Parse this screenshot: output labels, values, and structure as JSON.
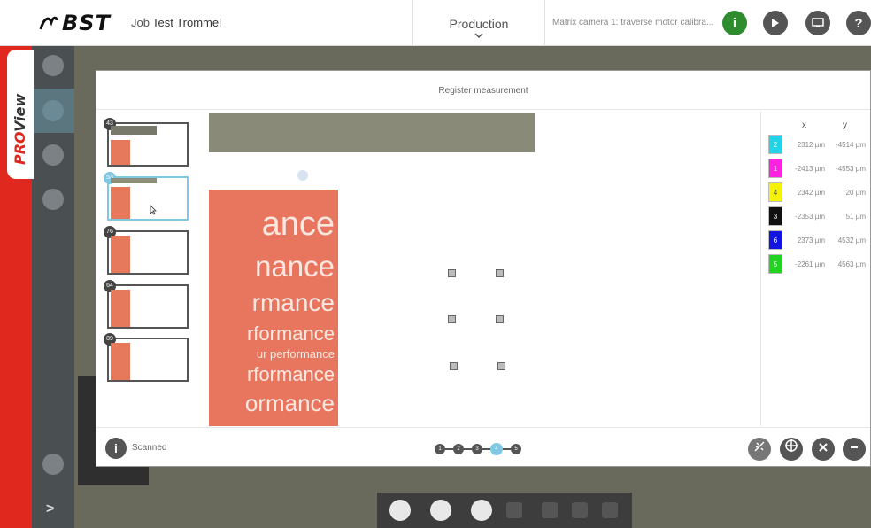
{
  "header": {
    "brand": "BST",
    "job_prefix": "Job",
    "job_name": "Test Trommel",
    "mode": "Production",
    "status_message": "Matrix camera 1: traverse motor calibra...",
    "status_color": "#2e8b2e"
  },
  "sidebar": {
    "app_name_pro": "PRO",
    "app_name_view": "View"
  },
  "dialog": {
    "title": "Register measurement",
    "thumbnails": [
      {
        "id": "43",
        "selected": false
      },
      {
        "id": "53",
        "selected": true
      },
      {
        "id": "76",
        "selected": false
      },
      {
        "id": "64",
        "selected": false
      },
      {
        "id": "89",
        "selected": false
      }
    ],
    "poster_lines": [
      "ance",
      "nance",
      "rmance",
      "rformance",
      "ur performance",
      "rformance",
      "ormance"
    ],
    "coords": {
      "x_label": "x",
      "y_label": "y",
      "rows": [
        {
          "num": "2",
          "color": "#22d3e8",
          "x": "2312 µm",
          "y": "-4514 µm"
        },
        {
          "num": "1",
          "color": "#ff22e0",
          "x": "-2413 µm",
          "y": "-4553 µm"
        },
        {
          "num": "4",
          "color": "#f5f20a",
          "x": "2342 µm",
          "y": "20 µm"
        },
        {
          "num": "3",
          "color": "#111111",
          "x": "-2353 µm",
          "y": "51 µm"
        },
        {
          "num": "6",
          "color": "#1414e0",
          "x": "2373 µm",
          "y": "4532 µm"
        },
        {
          "num": "5",
          "color": "#22d322",
          "x": "-2261 µm",
          "y": "4563 µm"
        }
      ]
    },
    "footer": {
      "info_glyph": "i",
      "status": "Scanned",
      "steps": [
        "1",
        "2",
        "3",
        "4",
        "5"
      ],
      "active_step": "4"
    }
  }
}
